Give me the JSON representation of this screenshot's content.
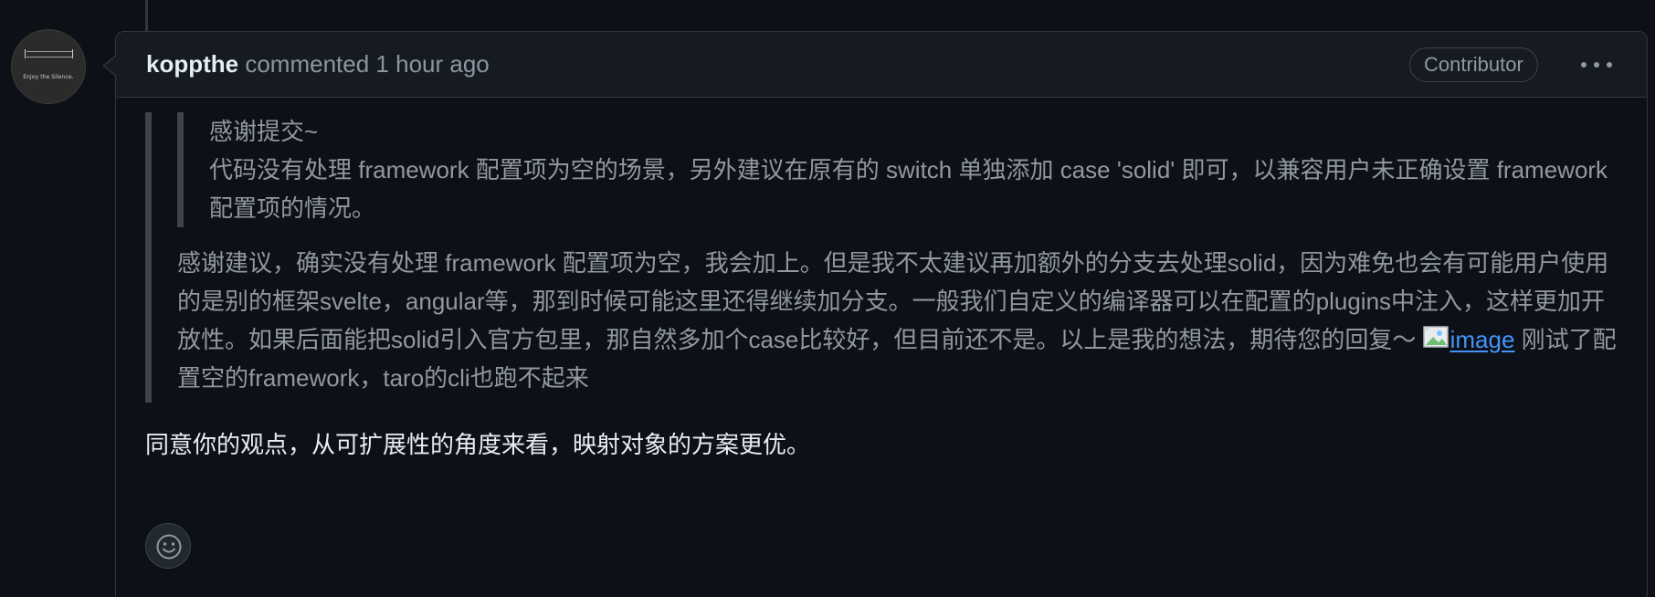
{
  "comment": {
    "author": "koppthe",
    "action": "commented",
    "timestamp": "1 hour ago",
    "badge": "Contributor",
    "avatar_caption": "Enjoy the Silence.",
    "inner_quote": {
      "line1": "感谢提交~",
      "line2": "代码没有处理 framework 配置项为空的场景，另外建议在原有的 switch 单独添加 case 'solid' 即可，以兼容用户未正确设置 framework 配置项的情况。"
    },
    "quoted_reply": {
      "text_before_image": "感谢建议，确实没有处理 framework 配置项为空，我会加上。但是我不太建议再加额外的分支去处理solid，因为难免也会有可能用户使用的是别的框架svelte，angular等，那到时候可能这里还得继续加分支。一般我们自定义的编译器可以在配置的plugins中注入，这样更加开放性。如果后面能把solid引入官方包里，那自然多加个case比较好，但目前还不是。以上是我的想法，期待您的回复～ ",
      "image_alt": "image",
      "text_after_image": " 刚试了配置空的framework，taro的cli也跑不起来"
    },
    "reply": "同意你的观点，从可扩展性的角度来看，映射对象的方案更优。"
  },
  "icons": {
    "more": "kebab-horizontal-icon",
    "emoji": "smiley-icon",
    "broken_image": "broken-image-icon"
  },
  "colors": {
    "background": "#0d1117",
    "header_background": "#161b22",
    "border": "#30363d",
    "muted_text": "#9198a1",
    "link": "#4493f8"
  }
}
